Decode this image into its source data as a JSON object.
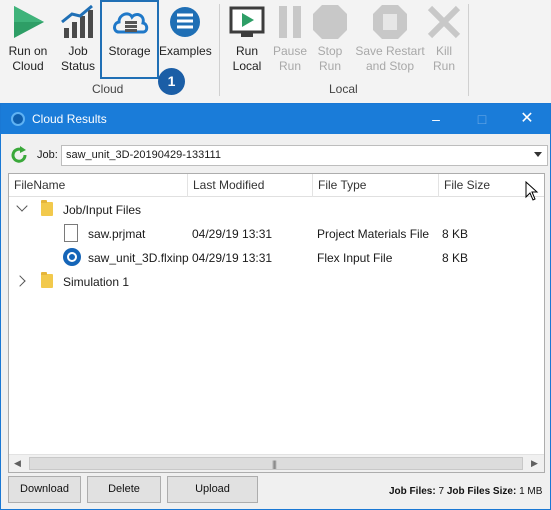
{
  "ribbon": {
    "cloud_group_label": "Cloud",
    "local_group_label": "Local",
    "buttons": [
      {
        "label_1": "Run on",
        "label_2": "Cloud",
        "icon": "play-icon"
      },
      {
        "label_1": "Job",
        "label_2": "Status",
        "icon": "bar-chart-icon"
      },
      {
        "label_1": "Storage",
        "label_2": "",
        "icon": "cloud-storage-icon"
      },
      {
        "label_1": "Examples",
        "label_2": "",
        "icon": "examples-icon"
      },
      {
        "label_1": "Run",
        "label_2": "Local",
        "icon": "monitor-play-icon"
      },
      {
        "label_1": "Pause",
        "label_2": "Run",
        "icon": "pause-icon"
      },
      {
        "label_1": "Stop",
        "label_2": "Run",
        "icon": "stop-icon"
      },
      {
        "label_1": "Save Restart",
        "label_2": "and Stop",
        "icon": "save-restart-icon"
      },
      {
        "label_1": "Kill",
        "label_2": "Run",
        "icon": "kill-icon"
      }
    ],
    "callout_number": "1"
  },
  "dialog": {
    "title": "Cloud Results",
    "job_label": "Job:",
    "job_value": "saw_unit_3D-20190429-133111",
    "columns": [
      "FileName",
      "Last Modified",
      "File Type",
      "File Size"
    ],
    "rows": [
      {
        "name": "Job/Input Files",
        "modified": "",
        "type": "",
        "size": ""
      },
      {
        "name": "saw.prjmat",
        "modified": "04/29/19 13:31",
        "type": "Project Materials File",
        "size": "8 KB"
      },
      {
        "name": "saw_unit_3D.flxinp",
        "modified": "04/29/19 13:31",
        "type": "Flex Input File",
        "size": "8 KB"
      },
      {
        "name": "Simulation 1",
        "modified": "",
        "type": "",
        "size": ""
      }
    ],
    "buttons": {
      "download": "Download",
      "delete": "Delete",
      "upload": "Upload"
    },
    "footer": {
      "job_files_label": "Job Files:",
      "job_files_value": "7",
      "job_files_size_label": "Job Files Size:",
      "job_files_size_value": "1 MB"
    }
  },
  "colors": {
    "accent": "#1a7cd9",
    "callout": "#1b5ea6",
    "play_green": "#2e9e66"
  }
}
